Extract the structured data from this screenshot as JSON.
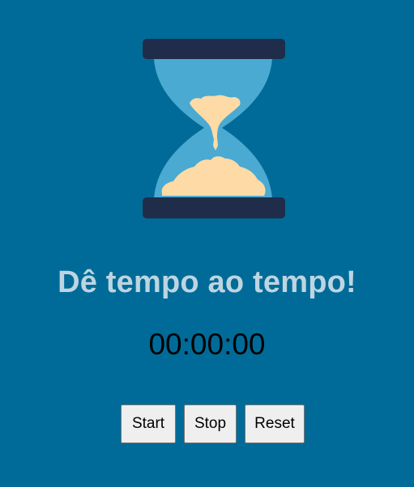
{
  "hourglass": {
    "icon": "hourglass-icon",
    "colors": {
      "frame": "#1f2d4a",
      "glass": "#4aaad2",
      "sand": "#fedba6"
    }
  },
  "title": "Dê tempo ao tempo!",
  "timer": {
    "display": "00:00:00"
  },
  "controls": {
    "start_label": "Start",
    "stop_label": "Stop",
    "reset_label": "Reset"
  },
  "colors": {
    "background": "#006b98",
    "title": "#bdd5e1",
    "timer": "#000000",
    "button_bg": "#efefef"
  }
}
